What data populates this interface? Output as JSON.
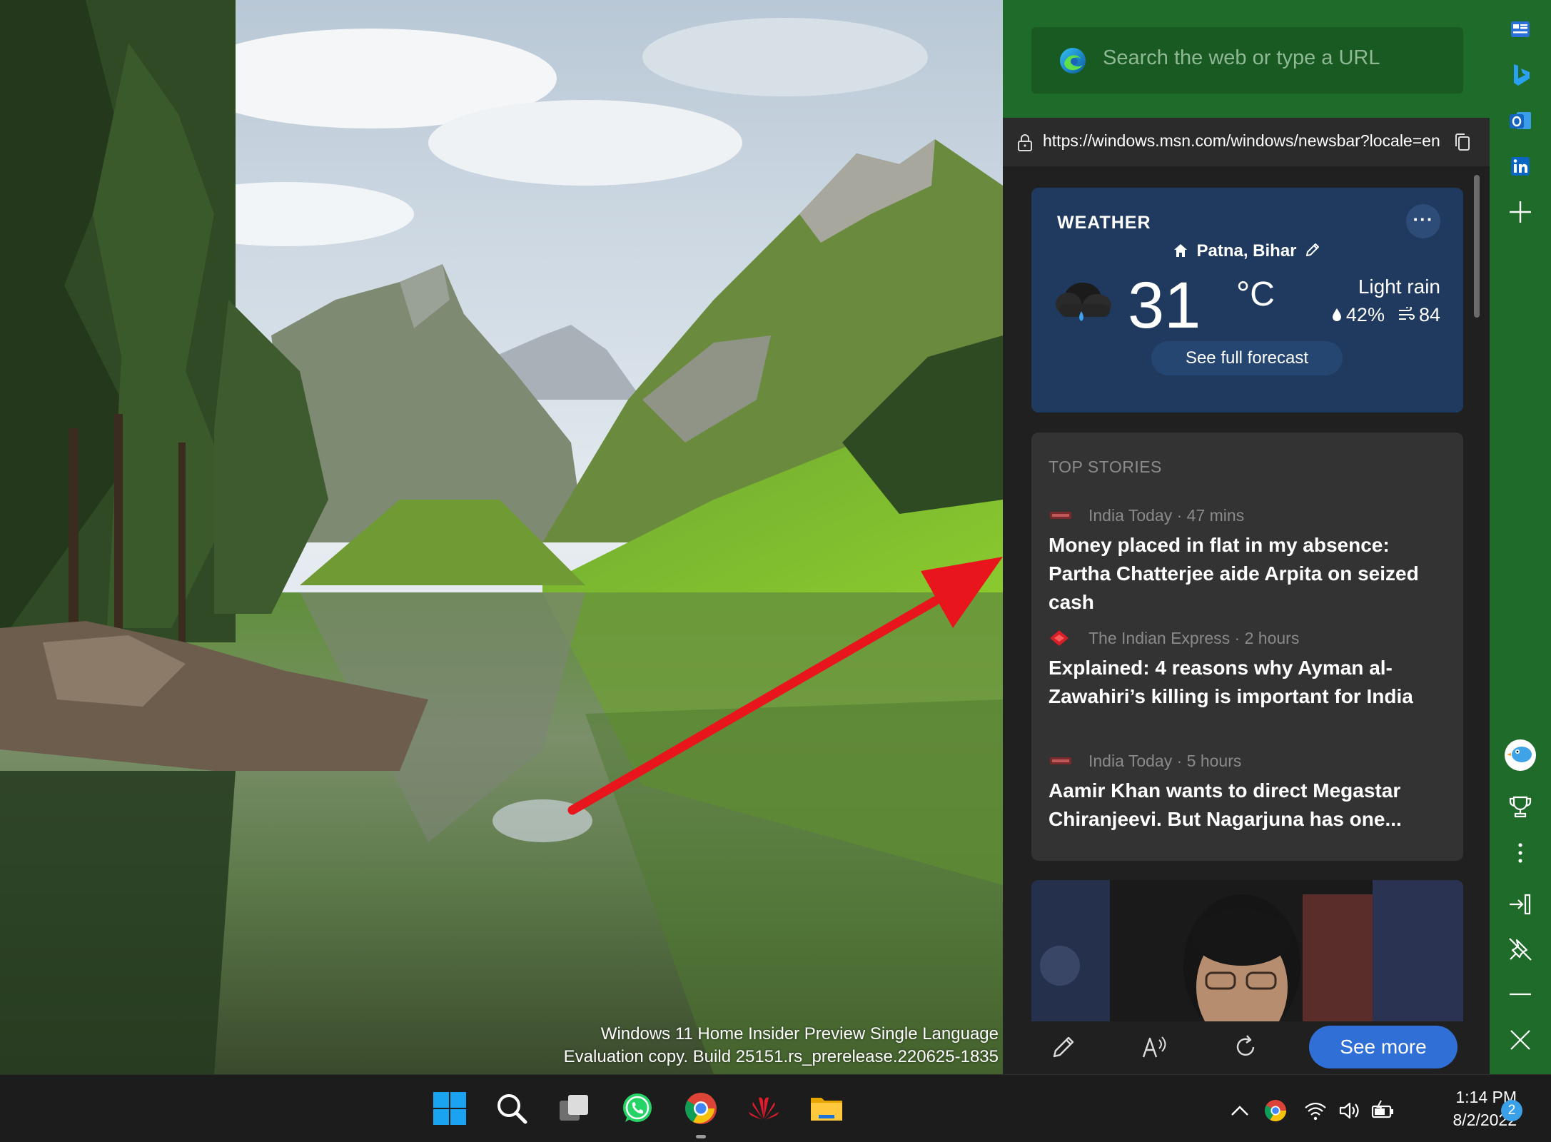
{
  "desktop": {
    "watermark_line1": "Windows 11 Home Insider Preview Single Language",
    "watermark_line2": "Evaluation copy. Build 25151.rs_prerelease.220625-1835"
  },
  "sidebar": {
    "search_placeholder": "Search the web or type a URL",
    "url": "https://windows.msn.com/windows/newsbar?locale=en",
    "weather": {
      "title": "WEATHER",
      "more_label": "···",
      "location": "Patna, Bihar",
      "temperature": "31",
      "unit": "°C",
      "condition": "Light rain",
      "humidity": "42%",
      "wind": "84",
      "forecast_button": "See full forecast"
    },
    "top_stories": {
      "title": "TOP STORIES",
      "items": [
        {
          "source": "India Today · 47 mins",
          "headline": "Money placed in flat in my absence: Partha Chatterjee aide Arpita on seized cash"
        },
        {
          "source": "The Indian Express · 2 hours",
          "headline": "Explained: 4 reasons why Ayman al-Zawahiri’s killing is important for India"
        },
        {
          "source": "India Today · 5 hours",
          "headline": "Aamir Khan wants to direct Megastar Chiranjeevi. But Nagarjuna has one..."
        }
      ]
    },
    "toolbar": {
      "see_more": "See more"
    }
  },
  "taskbar": {
    "time": "1:14 PM",
    "date": "8/2/2022",
    "notification_count": "2"
  },
  "colors": {
    "panel_green": "#1f6b2a",
    "weather_card": "#1f3a5e",
    "see_more_button": "#2f6fd6",
    "arrow_red": "#e8161c"
  }
}
